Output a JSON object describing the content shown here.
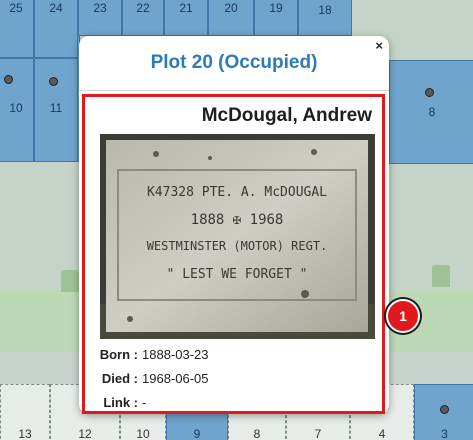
{
  "map": {
    "top_row_plots": [
      "25",
      "24",
      "23",
      "22",
      "21",
      "20",
      "19",
      "18"
    ],
    "second_row_plots": [
      "10",
      "11",
      "8"
    ],
    "bottom_row_plots": [
      "13",
      "12",
      "10",
      "9",
      "8",
      "7",
      "4",
      "3"
    ]
  },
  "popup": {
    "title": "Plot 20 (Occupied)",
    "close_label": "×",
    "name": "McDougal, Andrew",
    "headstone": {
      "line1": "K47328 PTE. A. McDOUGAL",
      "line2": "1888  ✠  1968",
      "line3": "WESTMINSTER (MOTOR) REGT.",
      "line4": "\" LEST WE FORGET \""
    },
    "born_label": "Born :",
    "born_value": "1888-03-23",
    "died_label": "Died :",
    "died_value": "1968-06-05",
    "link_label": "Link :",
    "link_value": "-"
  },
  "badge": {
    "label": "1",
    "color": "#e0191d"
  },
  "colors": {
    "plot_occupied": "#6fa4cc",
    "title_blue": "#2f7bb8",
    "highlight": "#e0191d"
  }
}
